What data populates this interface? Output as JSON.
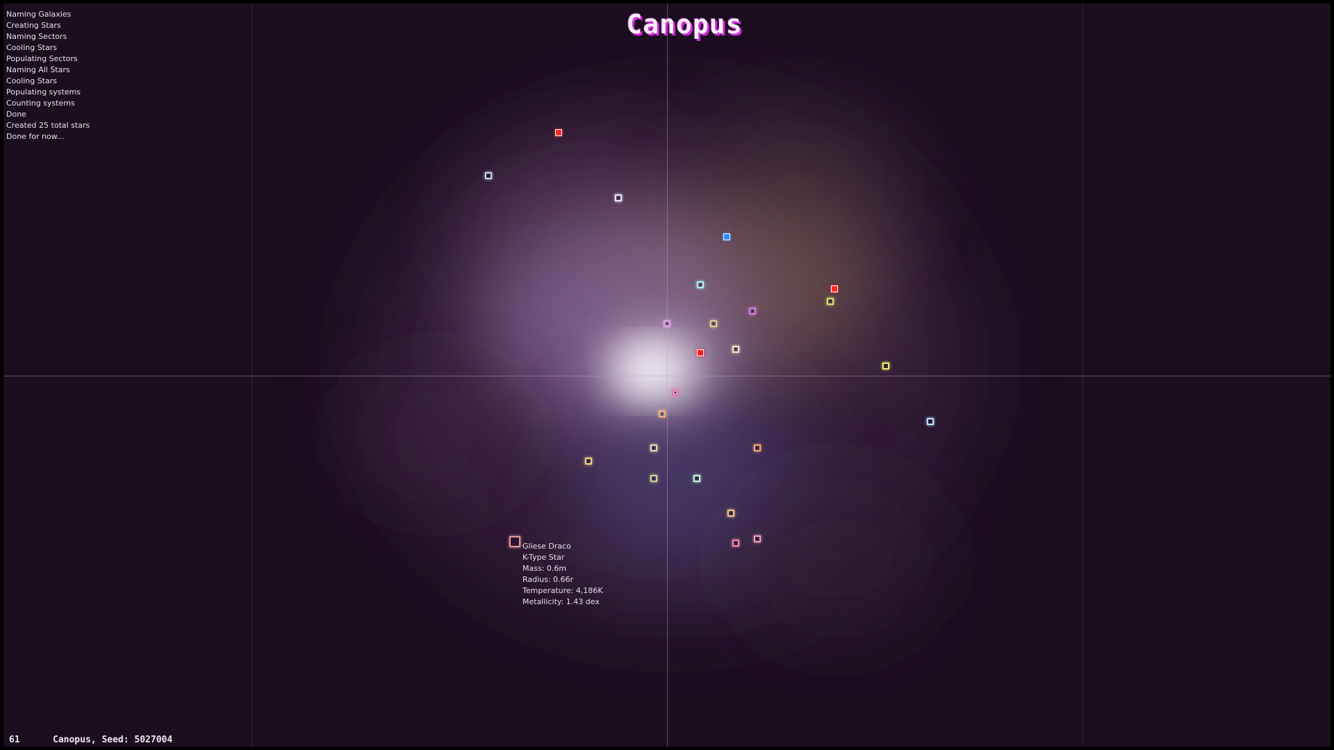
{
  "title": "Canopus",
  "log": [
    "Naming Galaxies",
    "Creating Stars",
    "Naming Sectors",
    "Cooling Stars",
    "Populating Sectors",
    "Naming All Stars",
    "Cooling Stars",
    "Populating systems",
    "Counting systems",
    "Done",
    "Created 25 total stars",
    "Done for now..."
  ],
  "selected_star": {
    "name": "Gliese Draco",
    "type": "K-Type Star",
    "mass": "Mass: 0.6m",
    "radius": "Radius: 0.66r",
    "temperature": "Temperature: 4,186K",
    "metallicity": "Metallicity: 1.43 dex",
    "color": "#e09a9a"
  },
  "status": {
    "fps": "61",
    "seed_line": "Canopus, Seed: 5027004"
  },
  "colors": {
    "background": "#1b0e1f",
    "title_shadow": "#d22ad8"
  },
  "stars": [
    {
      "color": "#ff2a2a",
      "style": "solid"
    },
    {
      "color": "#c9d6f2",
      "style": "ring"
    },
    {
      "color": "#e6e8ff",
      "style": "ring"
    },
    {
      "color": "#2f8cff",
      "style": "solid"
    },
    {
      "color": "#a8f0f2",
      "style": "ring"
    },
    {
      "color": "#ff2a2a",
      "style": "solid"
    },
    {
      "color": "#d6e27a",
      "style": "ring"
    },
    {
      "color": "#d080e0",
      "style": "ring"
    },
    {
      "color": "#e8a0e8",
      "style": "ring"
    },
    {
      "color": "#e6c98a",
      "style": "ring"
    },
    {
      "color": "#ff1e1e",
      "style": "solid"
    },
    {
      "color": "#f4e6c8",
      "style": "ring"
    },
    {
      "color": "#e6ea6a",
      "style": "ring"
    },
    {
      "color": "#f07ab0",
      "style": "ring"
    },
    {
      "color": "#f0b878",
      "style": "ring"
    },
    {
      "color": "#b8e4ff",
      "style": "ring"
    },
    {
      "color": "#d8e0b8",
      "style": "ring"
    },
    {
      "color": "#f2a870",
      "style": "ring"
    },
    {
      "color": "#f2cc88",
      "style": "ring"
    },
    {
      "color": "#c8d890",
      "style": "ring"
    },
    {
      "color": "#c8f2d8",
      "style": "ring"
    },
    {
      "color": "#f2c48a",
      "style": "ring"
    },
    {
      "color": "#f290a8",
      "style": "ring"
    },
    {
      "color": "#f2a0b8",
      "style": "ring"
    },
    {
      "color": "#e09a9a",
      "style": "selected"
    }
  ]
}
